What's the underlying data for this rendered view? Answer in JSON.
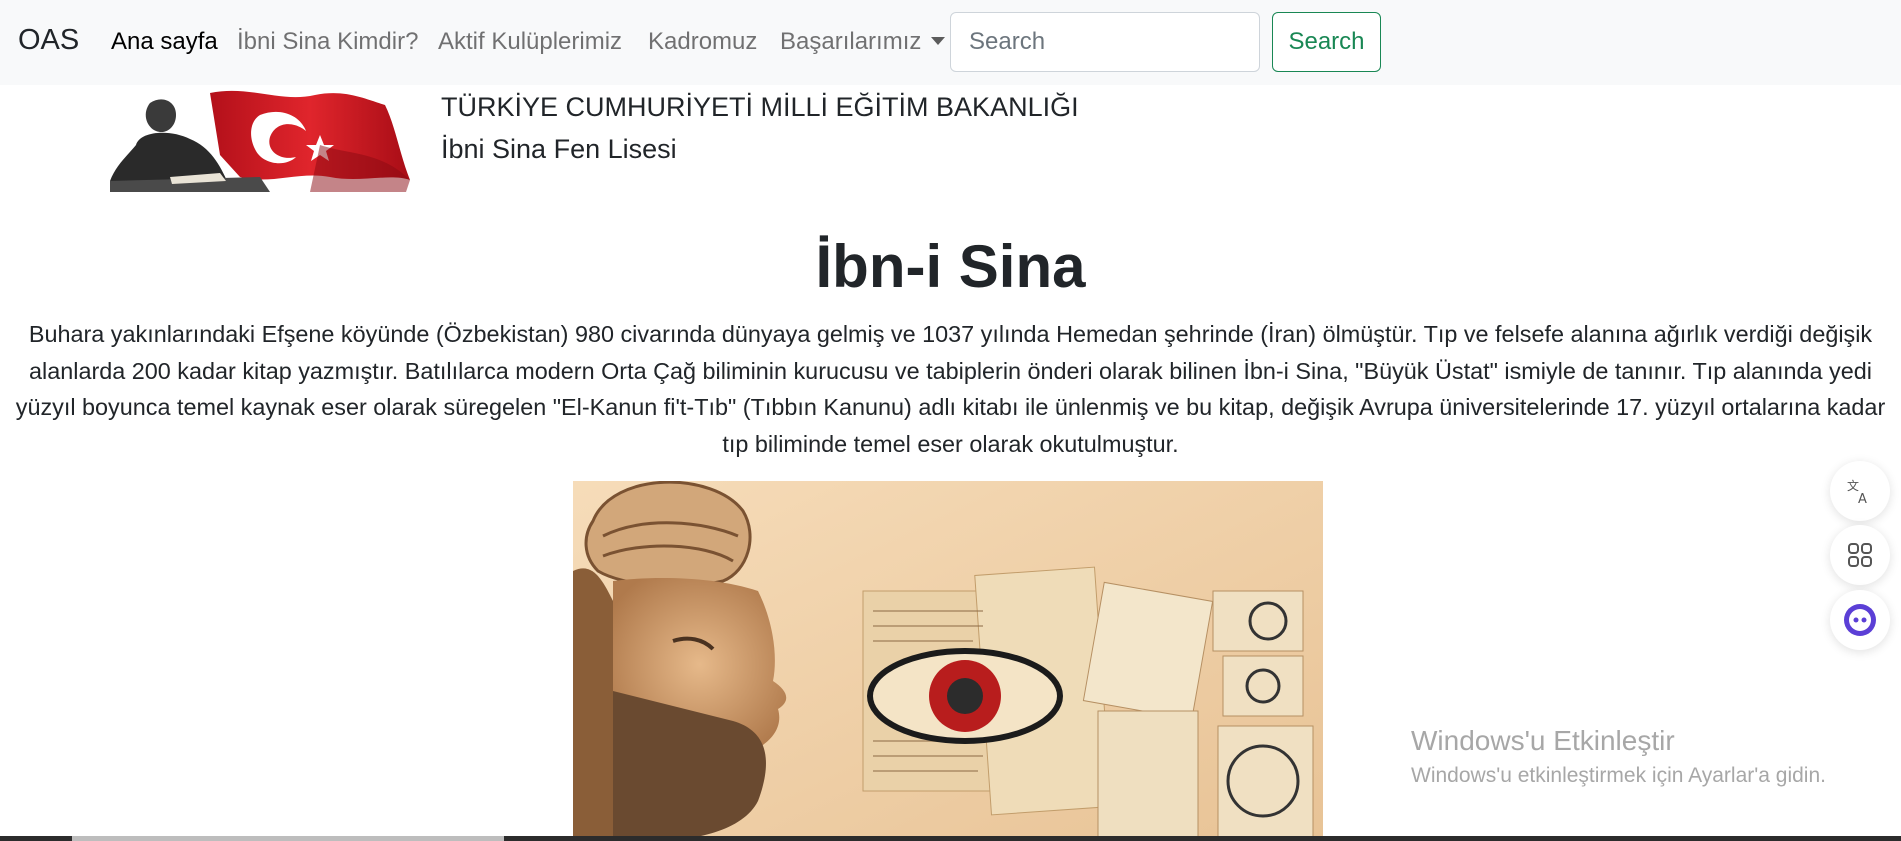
{
  "navbar": {
    "brand": "OAS",
    "links": [
      {
        "label": "Ana sayfa",
        "active": true
      },
      {
        "label": "İbni Sina Kimdir?",
        "active": false
      },
      {
        "label": "Aktif Kulüplerimiz",
        "active": false
      },
      {
        "label": "Kadromuz",
        "active": false
      },
      {
        "label": "Başarılarımız",
        "active": false,
        "dropdown": true
      }
    ],
    "search": {
      "placeholder": "Search",
      "button_label": "Search"
    }
  },
  "header": {
    "ministry": "TÜRKİYE CUMHURİYETİ MİLLİ EĞİTİM BAKANLIĞI",
    "school": "İbni Sina Fen Lisesi"
  },
  "main": {
    "title": "İbn-i Sina",
    "bio": "Buhara yakınlarındaki Efşene köyünde (Özbekistan) 980 civarında dünyaya gelmiş ve 1037 yılında Hemedan şehrinde (İran) ölmüştür. Tıp ve felsefe alanına ağırlık verdiği değişik alanlarda 200 kadar kitap yazmıştır. Batılılarca modern Orta Çağ biliminin kurucusu ve tabiplerin önderi olarak bilinen İbn-i Sina, \"Büyük Üstat\" ismiyle de tanınır. Tıp alanında yedi yüzyıl boyunca temel kaynak eser olarak süregelen \"El-Kanun fi't-Tıb\" (Tıbbın Kanunu) adlı kitabı ile ünlenmiş ve bu kitap, değişik Avrupa üniversitelerinde 17. yüzyıl ortalarına kadar tıp biliminde temel eser olarak okutulmuştur."
  },
  "floating_tools": [
    {
      "icon": "translate-icon"
    },
    {
      "icon": "apps-icon"
    },
    {
      "icon": "assistant-icon"
    }
  ],
  "watermark": {
    "title": "Windows'u Etkinleştir",
    "subtitle": "Windows'u etkinleştirmek için Ayarlar'a gidin."
  },
  "colors": {
    "navbar_bg": "#f8f9fa",
    "search_button": "#198754",
    "assistant_accent": "#5b3fd6"
  }
}
